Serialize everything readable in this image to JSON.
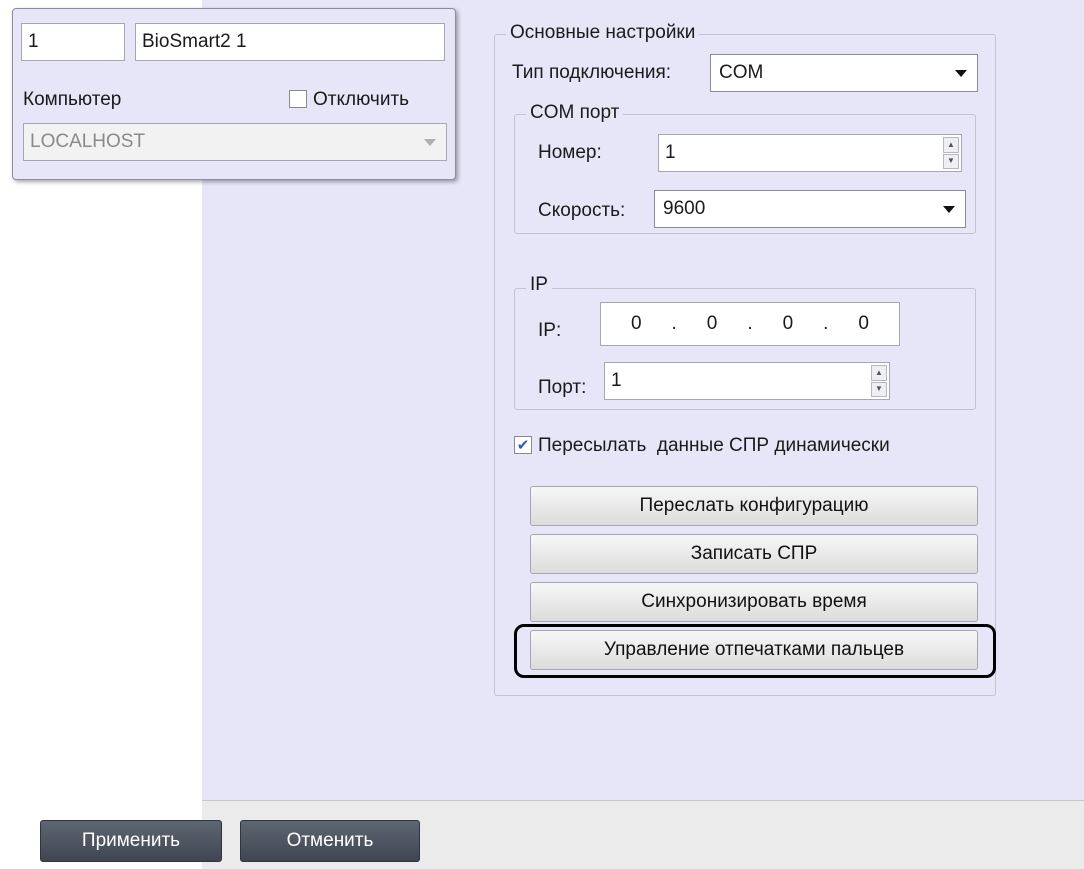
{
  "object_panel": {
    "id_value": "1",
    "name_value": "BioSmart2 1",
    "computer_label": "Компьютер",
    "disable_label": "Отключить",
    "disable_checked": false,
    "computer_value": "LOCALHOST"
  },
  "main_settings": {
    "title": "Основные настройки",
    "connection_type_label": "Тип подключения:",
    "connection_type_value": "COM",
    "com_port": {
      "title": "COM порт",
      "number_label": "Номер:",
      "number_value": "1",
      "speed_label": "Скорость:",
      "speed_value": "9600"
    },
    "ip": {
      "title": "IP",
      "ip_label": "IP:",
      "octets": [
        "0",
        "0",
        "0",
        "0"
      ],
      "port_label": "Порт:",
      "port_value": "1"
    },
    "send_dynamic_label": "Пересылать  данные СПР динамически",
    "send_dynamic_checked": true,
    "buttons": {
      "send_config": "Переслать конфигурацию",
      "write_spr": "Записать СПР",
      "sync_time": "Синхронизировать время",
      "manage_fingerprints": "Управление отпечатками пальцев"
    }
  },
  "footer": {
    "apply_label": "Применить",
    "cancel_label": "Отменить"
  },
  "colors": {
    "panel_bg": "#e6e6f8",
    "footer_button": "#4a525e",
    "check_mark": "#2f5fb0"
  }
}
